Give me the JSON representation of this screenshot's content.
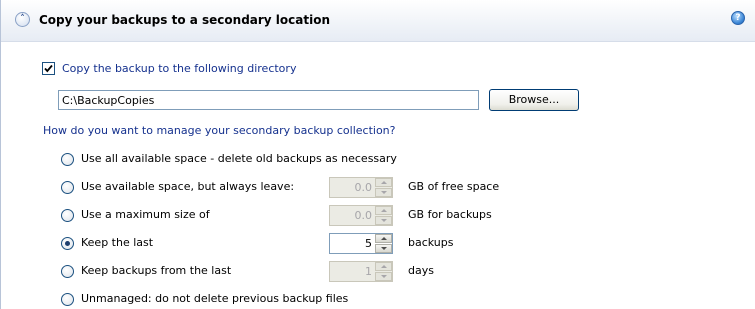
{
  "header": {
    "title": "Copy your backups to a secondary location",
    "collapse_glyph": "˄",
    "help_glyph": "?"
  },
  "copy": {
    "checkbox_checked": true,
    "label": "Copy the backup to the following directory",
    "path": "C:\\BackupCopies",
    "browse_label": "Browse..."
  },
  "collection": {
    "question": "How do you want to manage your secondary backup collection?",
    "options": [
      {
        "label": "Use all available space - delete old backups as necessary",
        "selected": false
      },
      {
        "label": "Use available space, but always leave:",
        "selected": false,
        "value": "0.0",
        "enabled": false,
        "suffix": "GB of free space"
      },
      {
        "label": "Use a maximum size of",
        "selected": false,
        "value": "0.0",
        "enabled": false,
        "suffix": "GB for backups"
      },
      {
        "label": "Keep the last",
        "selected": true,
        "value": "5",
        "enabled": true,
        "suffix": "backups"
      },
      {
        "label": "Keep backups from the last",
        "selected": false,
        "value": "1",
        "enabled": false,
        "suffix": "days"
      },
      {
        "label": "Unmanaged: do not delete previous backup files",
        "selected": false
      }
    ]
  },
  "colors": {
    "link_blue": "#15318e",
    "header_bg": "#eef2f8"
  }
}
